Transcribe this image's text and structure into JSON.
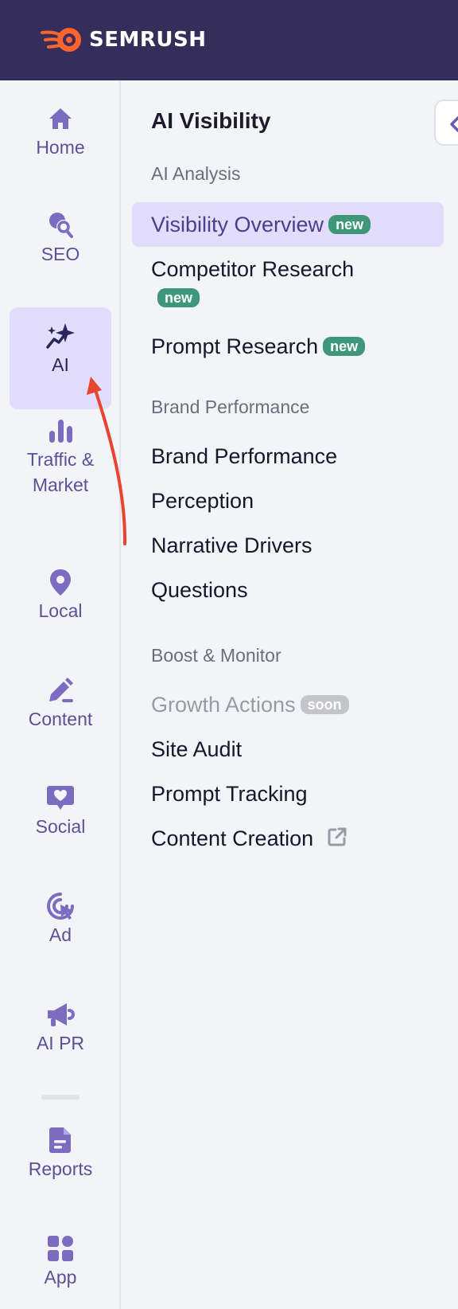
{
  "brand": {
    "name": "SEMRUSH",
    "accent": "#ff642d",
    "header_bg": "#362e5a"
  },
  "rail": {
    "items": [
      {
        "id": "home",
        "label": "Home",
        "icon": "home-icon"
      },
      {
        "id": "seo",
        "label": "SEO",
        "icon": "seo-icon"
      },
      {
        "id": "ai",
        "label": "AI",
        "icon": "sparkles-icon",
        "active": true
      },
      {
        "id": "traffic",
        "label": "Traffic &\nMarket",
        "icon": "bar-chart-icon"
      },
      {
        "id": "local",
        "label": "Local",
        "icon": "location-pin-icon"
      },
      {
        "id": "content",
        "label": "Content",
        "icon": "pencil-icon"
      },
      {
        "id": "social",
        "label": "Social",
        "icon": "heart-chat-icon"
      },
      {
        "id": "ad",
        "label": "Ad",
        "icon": "target-cursor-icon"
      },
      {
        "id": "aipr",
        "label": "AI PR",
        "icon": "megaphone-icon"
      },
      {
        "id": "reports",
        "label": "Reports",
        "icon": "document-icon"
      },
      {
        "id": "app",
        "label": "App",
        "icon": "app-grid-icon"
      }
    ]
  },
  "panel": {
    "title": "AI Visibility",
    "sections": [
      {
        "title": "AI Analysis",
        "items": [
          {
            "label": "Visibility Overview",
            "badge": "new",
            "active": true
          },
          {
            "label": "Competitor Research",
            "badge": "new"
          },
          {
            "label": "Prompt Research",
            "badge": "new"
          }
        ]
      },
      {
        "title": "Brand Performance",
        "items": [
          {
            "label": "Brand Performance"
          },
          {
            "label": "Perception"
          },
          {
            "label": "Narrative Drivers"
          },
          {
            "label": "Questions"
          }
        ]
      },
      {
        "title": "Boost & Monitor",
        "items": [
          {
            "label": "Growth Actions",
            "badge": "soon",
            "disabled": true
          },
          {
            "label": "Site Audit"
          },
          {
            "label": "Prompt Tracking"
          },
          {
            "label": "Content Creation",
            "icon": "external-link-icon"
          }
        ]
      }
    ]
  },
  "colors": {
    "active_bg": "#e1ddfb",
    "badge_new": "#3d9778",
    "badge_soon": "#c4c4cc",
    "arrow": "#e8442e"
  }
}
